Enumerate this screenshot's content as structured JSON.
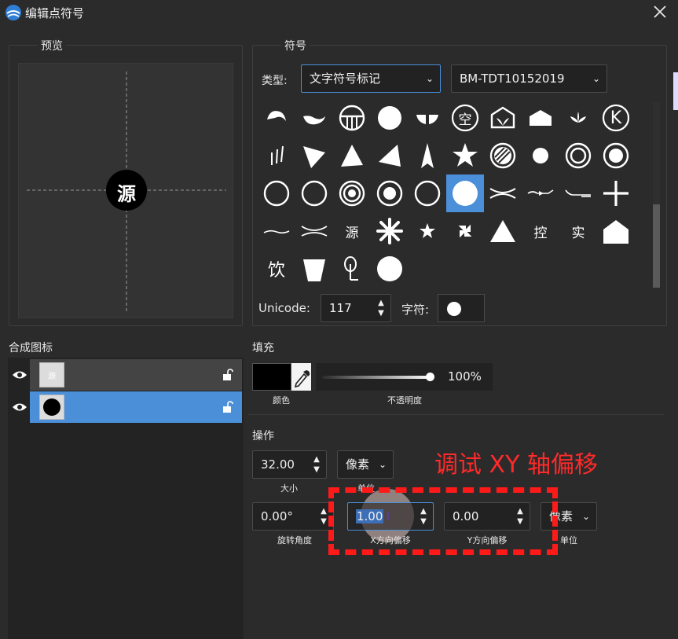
{
  "window": {
    "title": "编辑点符号",
    "close_icon": "close-icon"
  },
  "preview": {
    "group_label": "预览",
    "glyph": "源"
  },
  "symbol": {
    "group_label": "符号",
    "type_label": "类型:",
    "type_value": "文字符号标记",
    "font_value": "BM-TDT10152019",
    "grid_text": {
      "r0_kong": "空",
      "r0_k": "K",
      "r3_yuan": "源",
      "r3_kong": "控",
      "r3_shi": "实",
      "r4_yin": "饮"
    },
    "selected_index": 25,
    "unicode_label": "Unicode:",
    "unicode_value": "117",
    "char_label": "字符:"
  },
  "layers": {
    "label": "合成图标",
    "items": [
      {
        "thumb_text": "源",
        "visible": true,
        "selected": false
      },
      {
        "thumb_text": "",
        "visible": true,
        "selected": true
      }
    ]
  },
  "fill": {
    "label": "填充",
    "color_caption": "颜色",
    "color": "#000000",
    "opacity_value": "100%",
    "opacity_fraction": 1.0,
    "opacity_caption": "不透明度"
  },
  "operation": {
    "label": "操作",
    "size_value": "32.00",
    "size_caption": "大小",
    "unit_value": "像素",
    "unit_caption": "单位",
    "rotation_value": "0.00°",
    "rotation_caption": "旋转角度",
    "x_offset_value": "1.00",
    "x_offset_caption": "X方向偏移",
    "y_offset_value": "0.00",
    "y_offset_caption": "Y方向偏移",
    "offset_unit_value": "像素",
    "offset_unit_caption": "单位"
  },
  "annotation": {
    "text": "调试 XY 轴偏移",
    "color": "#ff2a2a"
  },
  "colors": {
    "accent": "#4a8fd8",
    "background": "#2b2b2b",
    "annotation_red": "#ff1a1a"
  }
}
